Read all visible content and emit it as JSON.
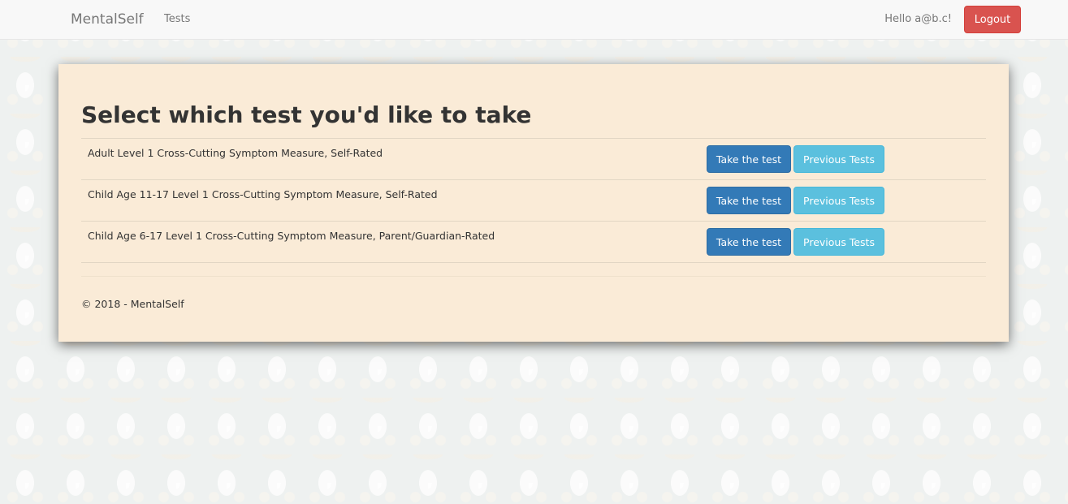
{
  "navbar": {
    "brand": "MentalSelf",
    "links": [
      "Tests"
    ],
    "greeting": "Hello a@b.c!",
    "logout_label": "Logout"
  },
  "main": {
    "title": "Select which test you'd like to take",
    "tests": [
      {
        "name": "Adult Level 1 Cross-Cutting Symptom Measure, Self-Rated",
        "take_label": "Take the test",
        "previous_label": "Previous Tests"
      },
      {
        "name": "Child Age 11-17 Level 1 Cross-Cutting Symptom Measure, Self-Rated",
        "take_label": "Take the test",
        "previous_label": "Previous Tests"
      },
      {
        "name": "Child Age 6-17 Level 1 Cross-Cutting Symptom Measure, Parent/Guardian-Rated",
        "take_label": "Take the test",
        "previous_label": "Previous Tests"
      }
    ]
  },
  "footer": {
    "text": "© 2018 - MentalSelf"
  },
  "colors": {
    "panel_background": "#faebd7",
    "primary": "#337ab7",
    "info": "#5bc0de",
    "danger": "#d9534f"
  }
}
